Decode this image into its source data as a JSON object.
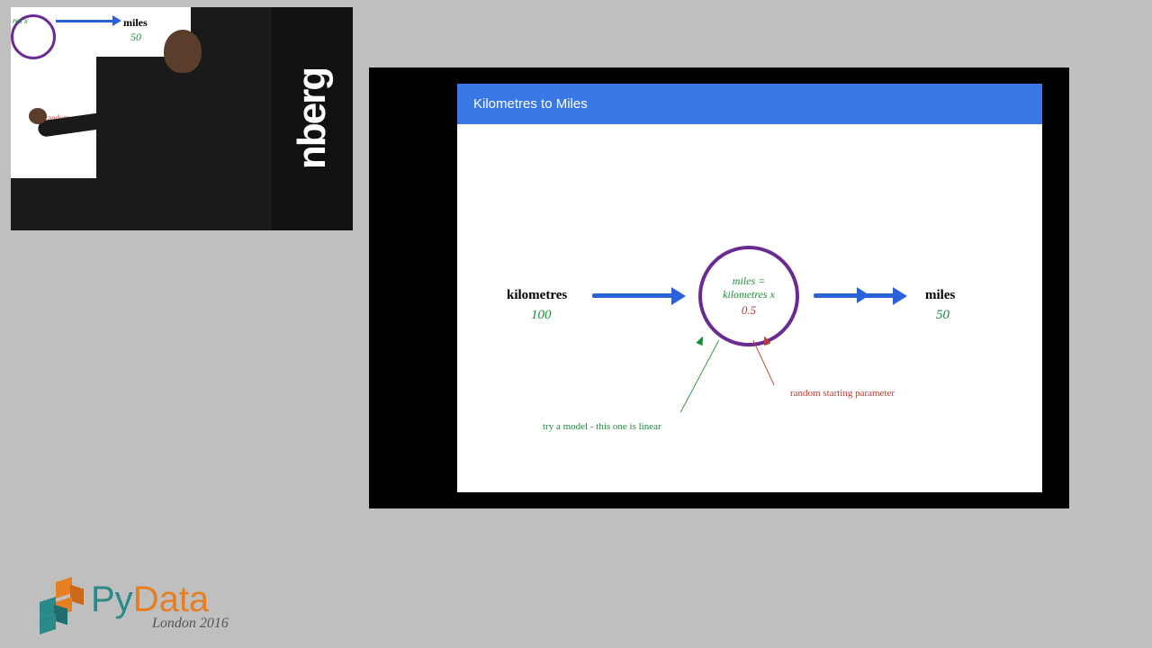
{
  "slide": {
    "title": "Kilometres to Miles",
    "input_label": "kilometres",
    "input_value": "100",
    "output_label": "miles",
    "output_value": "50",
    "model_line1": "miles =",
    "model_line2": "kilometres x",
    "model_param": "0.5",
    "anno_red": "random starting parameter",
    "anno_green": "try a model -  this one is linear"
  },
  "cam": {
    "miles": "miles",
    "miles_val": "50",
    "resx": "res x",
    "random": "random starting parameter",
    "panel": "nberg"
  },
  "logo": {
    "py": "Py",
    "data": "Data",
    "sub": "London 2016"
  }
}
